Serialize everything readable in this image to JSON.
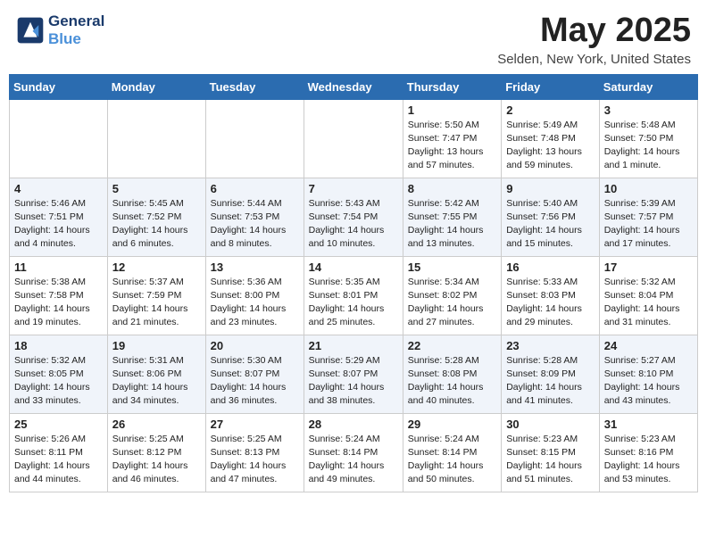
{
  "header": {
    "logo_line1": "General",
    "logo_line2": "Blue",
    "month_title": "May 2025",
    "location": "Selden, New York, United States"
  },
  "days_of_week": [
    "Sunday",
    "Monday",
    "Tuesday",
    "Wednesday",
    "Thursday",
    "Friday",
    "Saturday"
  ],
  "weeks": [
    [
      {
        "day": "",
        "info": ""
      },
      {
        "day": "",
        "info": ""
      },
      {
        "day": "",
        "info": ""
      },
      {
        "day": "",
        "info": ""
      },
      {
        "day": "1",
        "info": "Sunrise: 5:50 AM\nSunset: 7:47 PM\nDaylight: 13 hours\nand 57 minutes."
      },
      {
        "day": "2",
        "info": "Sunrise: 5:49 AM\nSunset: 7:48 PM\nDaylight: 13 hours\nand 59 minutes."
      },
      {
        "day": "3",
        "info": "Sunrise: 5:48 AM\nSunset: 7:50 PM\nDaylight: 14 hours\nand 1 minute."
      }
    ],
    [
      {
        "day": "4",
        "info": "Sunrise: 5:46 AM\nSunset: 7:51 PM\nDaylight: 14 hours\nand 4 minutes."
      },
      {
        "day": "5",
        "info": "Sunrise: 5:45 AM\nSunset: 7:52 PM\nDaylight: 14 hours\nand 6 minutes."
      },
      {
        "day": "6",
        "info": "Sunrise: 5:44 AM\nSunset: 7:53 PM\nDaylight: 14 hours\nand 8 minutes."
      },
      {
        "day": "7",
        "info": "Sunrise: 5:43 AM\nSunset: 7:54 PM\nDaylight: 14 hours\nand 10 minutes."
      },
      {
        "day": "8",
        "info": "Sunrise: 5:42 AM\nSunset: 7:55 PM\nDaylight: 14 hours\nand 13 minutes."
      },
      {
        "day": "9",
        "info": "Sunrise: 5:40 AM\nSunset: 7:56 PM\nDaylight: 14 hours\nand 15 minutes."
      },
      {
        "day": "10",
        "info": "Sunrise: 5:39 AM\nSunset: 7:57 PM\nDaylight: 14 hours\nand 17 minutes."
      }
    ],
    [
      {
        "day": "11",
        "info": "Sunrise: 5:38 AM\nSunset: 7:58 PM\nDaylight: 14 hours\nand 19 minutes."
      },
      {
        "day": "12",
        "info": "Sunrise: 5:37 AM\nSunset: 7:59 PM\nDaylight: 14 hours\nand 21 minutes."
      },
      {
        "day": "13",
        "info": "Sunrise: 5:36 AM\nSunset: 8:00 PM\nDaylight: 14 hours\nand 23 minutes."
      },
      {
        "day": "14",
        "info": "Sunrise: 5:35 AM\nSunset: 8:01 PM\nDaylight: 14 hours\nand 25 minutes."
      },
      {
        "day": "15",
        "info": "Sunrise: 5:34 AM\nSunset: 8:02 PM\nDaylight: 14 hours\nand 27 minutes."
      },
      {
        "day": "16",
        "info": "Sunrise: 5:33 AM\nSunset: 8:03 PM\nDaylight: 14 hours\nand 29 minutes."
      },
      {
        "day": "17",
        "info": "Sunrise: 5:32 AM\nSunset: 8:04 PM\nDaylight: 14 hours\nand 31 minutes."
      }
    ],
    [
      {
        "day": "18",
        "info": "Sunrise: 5:32 AM\nSunset: 8:05 PM\nDaylight: 14 hours\nand 33 minutes."
      },
      {
        "day": "19",
        "info": "Sunrise: 5:31 AM\nSunset: 8:06 PM\nDaylight: 14 hours\nand 34 minutes."
      },
      {
        "day": "20",
        "info": "Sunrise: 5:30 AM\nSunset: 8:07 PM\nDaylight: 14 hours\nand 36 minutes."
      },
      {
        "day": "21",
        "info": "Sunrise: 5:29 AM\nSunset: 8:07 PM\nDaylight: 14 hours\nand 38 minutes."
      },
      {
        "day": "22",
        "info": "Sunrise: 5:28 AM\nSunset: 8:08 PM\nDaylight: 14 hours\nand 40 minutes."
      },
      {
        "day": "23",
        "info": "Sunrise: 5:28 AM\nSunset: 8:09 PM\nDaylight: 14 hours\nand 41 minutes."
      },
      {
        "day": "24",
        "info": "Sunrise: 5:27 AM\nSunset: 8:10 PM\nDaylight: 14 hours\nand 43 minutes."
      }
    ],
    [
      {
        "day": "25",
        "info": "Sunrise: 5:26 AM\nSunset: 8:11 PM\nDaylight: 14 hours\nand 44 minutes."
      },
      {
        "day": "26",
        "info": "Sunrise: 5:25 AM\nSunset: 8:12 PM\nDaylight: 14 hours\nand 46 minutes."
      },
      {
        "day": "27",
        "info": "Sunrise: 5:25 AM\nSunset: 8:13 PM\nDaylight: 14 hours\nand 47 minutes."
      },
      {
        "day": "28",
        "info": "Sunrise: 5:24 AM\nSunset: 8:14 PM\nDaylight: 14 hours\nand 49 minutes."
      },
      {
        "day": "29",
        "info": "Sunrise: 5:24 AM\nSunset: 8:14 PM\nDaylight: 14 hours\nand 50 minutes."
      },
      {
        "day": "30",
        "info": "Sunrise: 5:23 AM\nSunset: 8:15 PM\nDaylight: 14 hours\nand 51 minutes."
      },
      {
        "day": "31",
        "info": "Sunrise: 5:23 AM\nSunset: 8:16 PM\nDaylight: 14 hours\nand 53 minutes."
      }
    ]
  ]
}
